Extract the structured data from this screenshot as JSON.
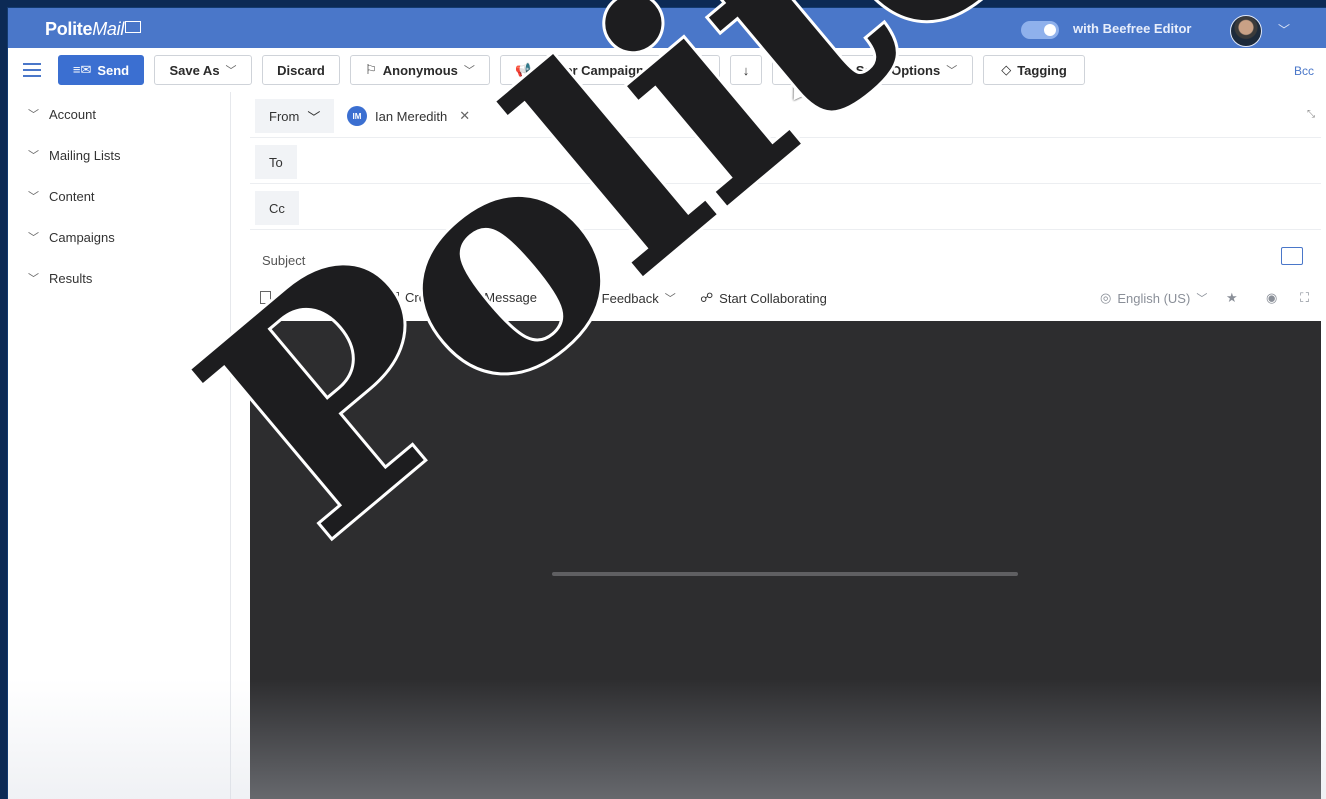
{
  "brand": {
    "logo_a": "Polite",
    "logo_b": "Mail"
  },
  "header": {
    "editor_toggle_label": "with Beefree Editor",
    "editor_toggle_on": true
  },
  "toolbar": {
    "send_label": "Send",
    "save_as_label": "Save As",
    "discard_label": "Discard",
    "sender_label": "Anonymous",
    "campaign_label": "Winter Campaign",
    "priority_high_symbol": "!",
    "priority_low_symbol": "↓",
    "send_options_label": "Send Options",
    "tagging_label": "Tagging",
    "bcc_label": "Bcc"
  },
  "sidebar": {
    "items": [
      {
        "label": "Account"
      },
      {
        "label": "Mailing Lists"
      },
      {
        "label": "Content"
      },
      {
        "label": "Campaigns"
      },
      {
        "label": "Results"
      }
    ]
  },
  "compose": {
    "from_label": "From",
    "from_name": "Ian Meredith",
    "from_initials": "IM",
    "to_label": "To",
    "cc_label": "Cc",
    "subject_placeholder": "Subject"
  },
  "editor_tools": {
    "select_template": "Select Template",
    "create_video": "Create Video Message",
    "add_feedback": "Add Feedback",
    "start_collab": "Start Collaborating",
    "language": "English (US)"
  },
  "editor": {
    "loading_progress": 0
  },
  "watermark": {
    "text": "PoliteMail"
  },
  "colors": {
    "brand_blue": "#4a77c9",
    "accent_blue": "#3b6fd1",
    "editor_bg": "#2d2d2f",
    "border_navy": "#0c2a55"
  }
}
